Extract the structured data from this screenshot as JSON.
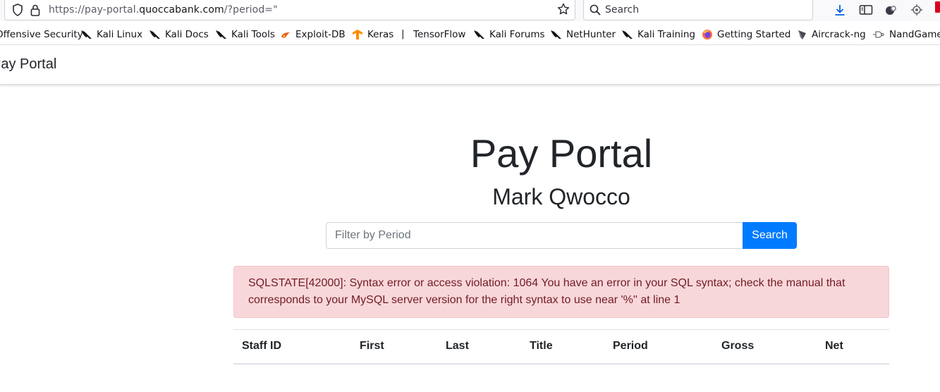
{
  "browser": {
    "url_prefix": "https://pay-portal.",
    "url_domain": "quoccabank.com",
    "url_suffix": "/?period=\"",
    "search_placeholder": "Search"
  },
  "bookmarks": [
    {
      "label": "Offensive Security",
      "icon": "kali-dragon-icon"
    },
    {
      "label": "Kali Linux",
      "icon": "kali-dragon-icon"
    },
    {
      "label": "Kali Docs",
      "icon": "kali-dragon-icon"
    },
    {
      "label": "Kali Tools",
      "icon": "kali-dragon-icon"
    },
    {
      "label": "Exploit-DB",
      "icon": "exploit-db-icon"
    },
    {
      "label": "Keras",
      "icon": "keras-icon"
    },
    {
      "label": "TensorFlow",
      "icon": "separator"
    },
    {
      "label": "Kali Forums",
      "icon": "kali-dragon-icon"
    },
    {
      "label": "NetHunter",
      "icon": "kali-dragon-icon"
    },
    {
      "label": "Kali Training",
      "icon": "kali-dragon-icon"
    },
    {
      "label": "Getting Started",
      "icon": "firefox-icon"
    },
    {
      "label": "Aircrack-ng",
      "icon": "aircrack-icon"
    },
    {
      "label": "NandGame",
      "icon": "nand-icon"
    }
  ],
  "navbar": {
    "brand": "Pay Portal"
  },
  "page": {
    "title": "Pay Portal",
    "subtitle": "Mark Qwocco",
    "filter_placeholder": "Filter by Period",
    "search_button": "Search",
    "error": "SQLSTATE[42000]: Syntax error or access violation: 1064 You have an error in your SQL syntax; check the manual that corresponds to your MySQL server version for the right syntax to use near '%'' at line 1"
  },
  "table": {
    "headers": [
      "Staff ID",
      "First",
      "Last",
      "Title",
      "Period",
      "Gross",
      "Net"
    ]
  },
  "colors": {
    "primary": "#007bff",
    "alert_bg": "#f8d7da",
    "alert_text": "#721c24"
  }
}
